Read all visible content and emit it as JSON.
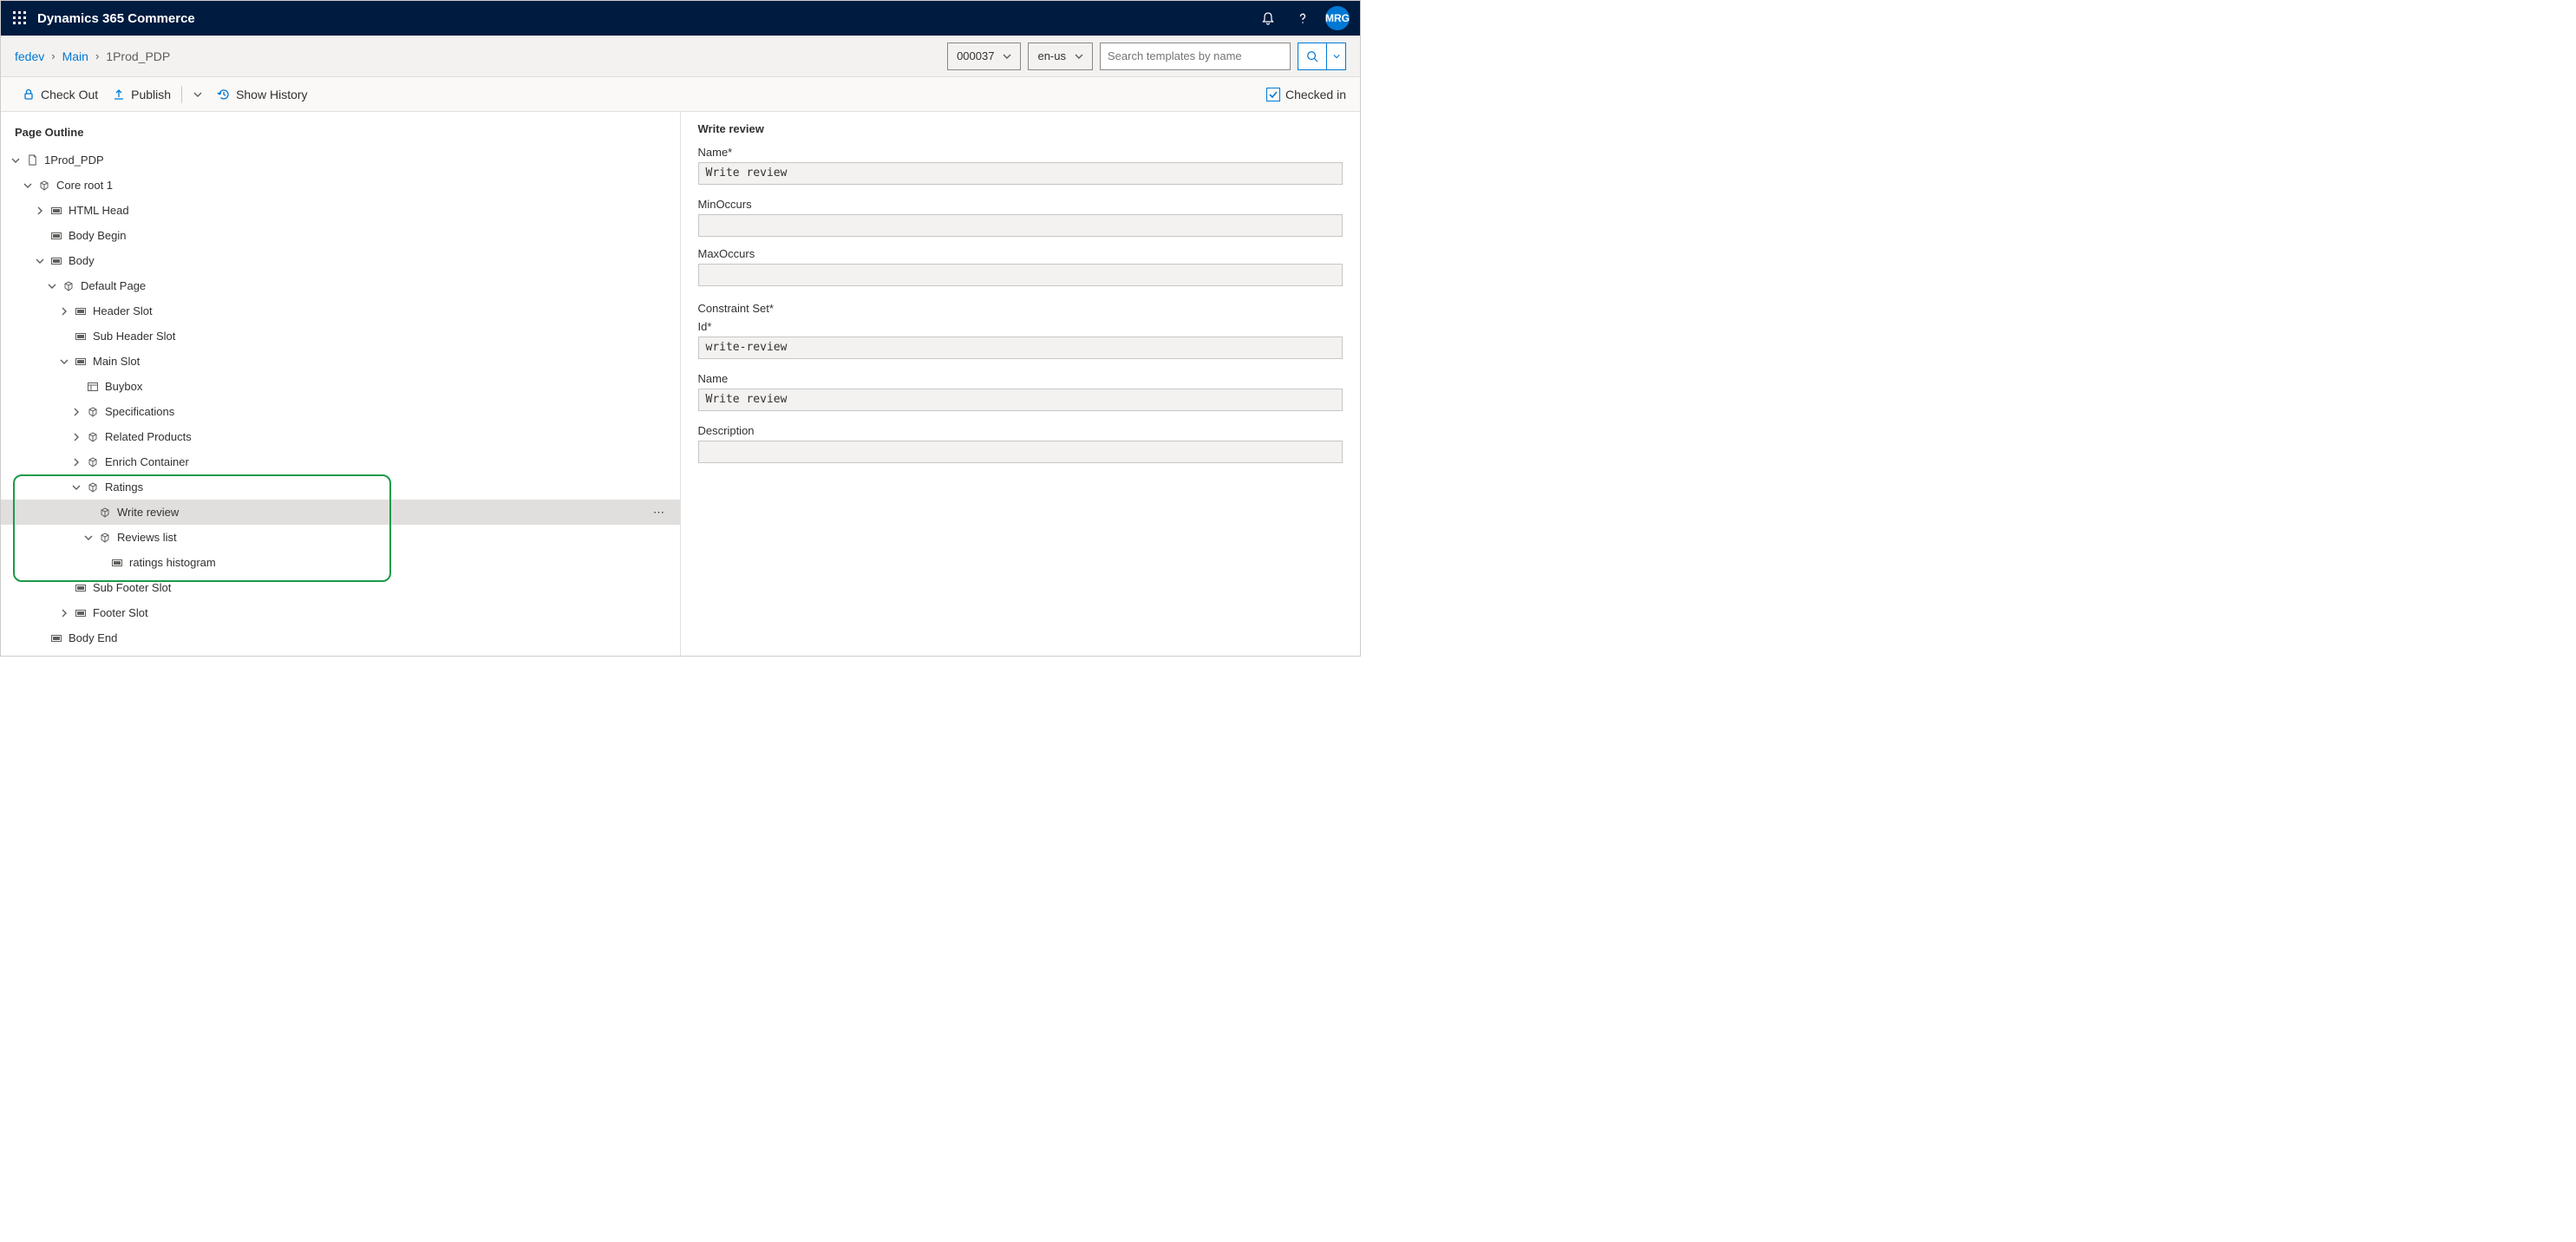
{
  "header": {
    "app_title": "Dynamics 365 Commerce",
    "avatar_initials": "MRG"
  },
  "breadcrumb": {
    "items": [
      "fedev",
      "Main",
      "1Prod_PDP"
    ],
    "site_select": "000037",
    "locale": "en-us",
    "search_placeholder": "Search templates by name"
  },
  "commands": {
    "checkout": "Check Out",
    "publish": "Publish",
    "history": "Show History",
    "checkedin": "Checked in"
  },
  "outline": {
    "title": "Page Outline",
    "nodes": {
      "root": "1Prod_PDP",
      "core": "Core root 1",
      "headslot": "HTML Head",
      "bodybegin": "Body Begin",
      "body": "Body",
      "defaultpage": "Default Page",
      "headerslot": "Header Slot",
      "subheaderslot": "Sub Header Slot",
      "mainslot": "Main Slot",
      "buybox": "Buybox",
      "specs": "Specifications",
      "related": "Related Products",
      "enrich": "Enrich Container",
      "ratings": "Ratings",
      "writereview": "Write review",
      "reviewslist": "Reviews list",
      "histogram": "ratings histogram",
      "subfooter": "Sub Footer Slot",
      "footerslot": "Footer Slot",
      "bodyend": "Body End"
    }
  },
  "panel": {
    "title": "Write review",
    "name_label": "Name*",
    "name_value": "Write review",
    "min_label": "MinOccurs",
    "min_value": "",
    "max_label": "MaxOccurs",
    "max_value": "",
    "constraint_label": "Constraint Set*",
    "id_label": "Id*",
    "id_value": "write-review",
    "name2_label": "Name",
    "name2_value": "Write review",
    "desc_label": "Description",
    "desc_value": ""
  }
}
